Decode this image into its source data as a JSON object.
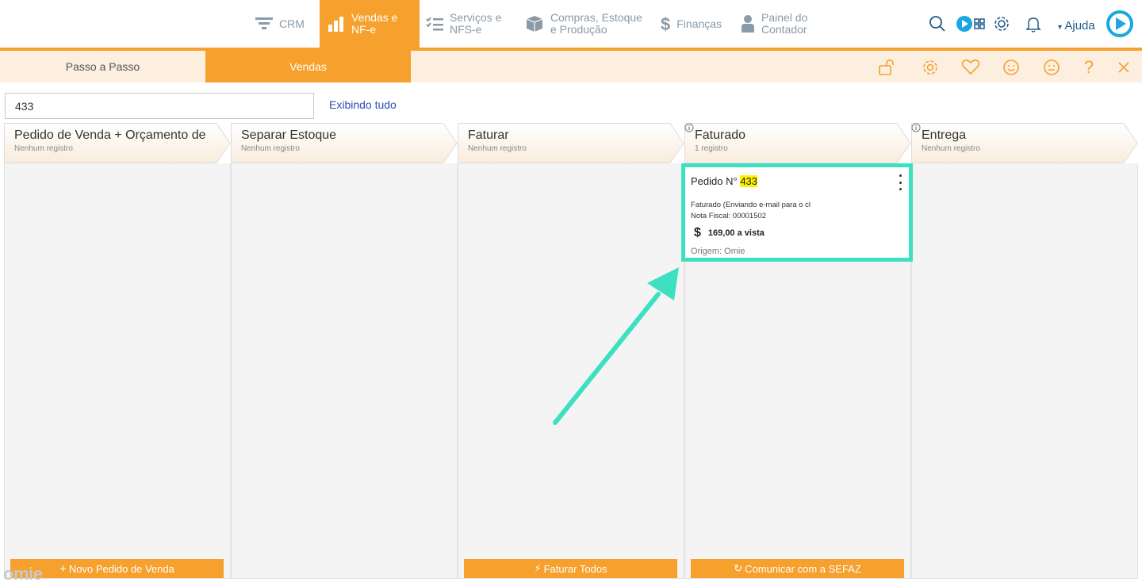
{
  "nav": {
    "items": [
      {
        "label": "CRM",
        "icon": "funnel-icon"
      },
      {
        "label": "Vendas e\nNF-e",
        "icon": "chart-bars-icon"
      },
      {
        "label": "Serviços e\nNFS-e",
        "icon": "checklist-icon"
      },
      {
        "label": "Compras, Estoque\ne Produção",
        "icon": "box-icon"
      },
      {
        "label": "Finanças",
        "icon": "dollar-icon"
      },
      {
        "label": "Painel do\nContador",
        "icon": "person-icon"
      }
    ],
    "help_label": "Ajuda"
  },
  "subnav": {
    "tabs": [
      "Passo a Passo",
      "Vendas"
    ]
  },
  "search": {
    "value": "433",
    "show_all_label": "Exibindo tudo"
  },
  "columns": [
    {
      "title": "Pedido de Venda + Orçamento de",
      "subtitle": "Nenhum registro",
      "button": "Novo Pedido de Venda"
    },
    {
      "title": "Separar Estoque",
      "subtitle": "Nenhum registro"
    },
    {
      "title": "Faturar",
      "subtitle": "Nenhum registro",
      "button": "Faturar Todos"
    },
    {
      "title": "Faturado",
      "subtitle": "1 registro",
      "button": "Comunicar com a SEFAZ"
    },
    {
      "title": "Entrega",
      "subtitle": "Nenhum registro"
    }
  ],
  "card": {
    "title_prefix": "Pedido N°",
    "number": "433",
    "status": "Faturado (Enviando e-mail para o cl",
    "nota_fiscal": "Nota Fiscal: 00001502",
    "currency_symbol": "$",
    "value": "169,00 a vista",
    "origin": "Origem: Omie"
  },
  "brand": {
    "logo_text": "omie",
    "accent": "#f6a02d",
    "highlight": "#3ee0c2"
  }
}
